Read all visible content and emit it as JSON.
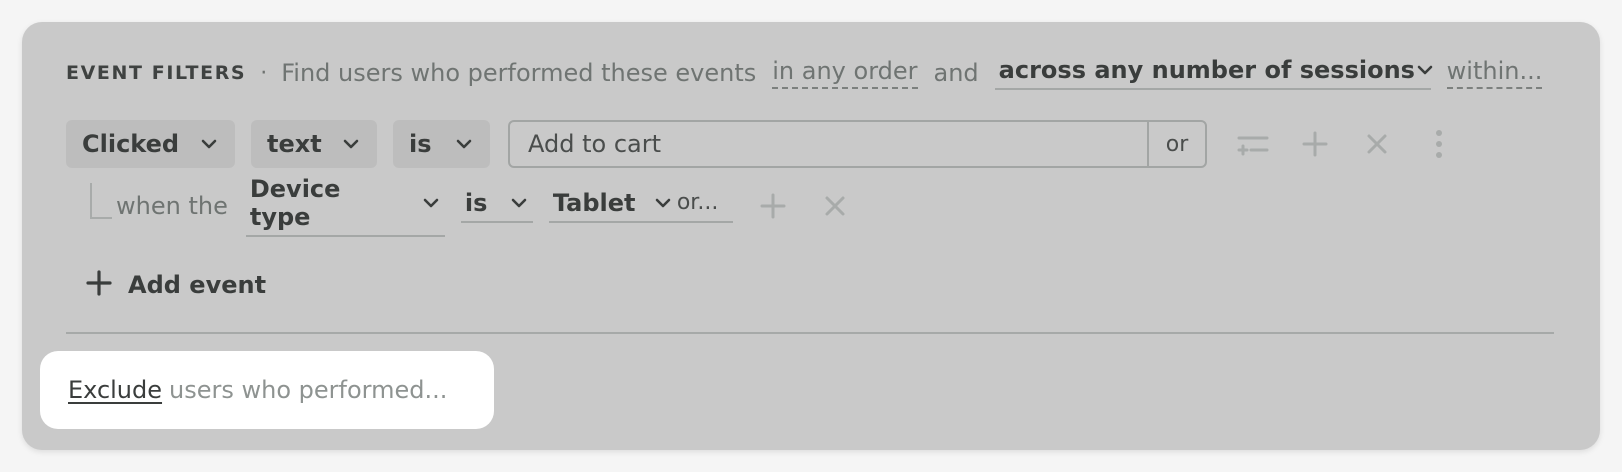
{
  "header": {
    "title": "EVENT FILTERS",
    "separator": "·",
    "description": "Find users who performed these events",
    "order_link": "in any order",
    "conjunction": "and",
    "sessions_select": "across any number of sessions",
    "within_link": "within..."
  },
  "event_row": {
    "action_select": "Clicked",
    "property_select": "text",
    "operator_select": "is",
    "value_input": "Add to cart",
    "or_button": "or",
    "icons": [
      "filter-toggle-icon",
      "add-icon",
      "remove-icon",
      "more-vertical-icon"
    ]
  },
  "condition_row": {
    "prefix": "when the",
    "property_select": "Device type",
    "operator_select": "is",
    "value_select": "Tablet",
    "or_more": "or...",
    "icons": [
      "add-icon",
      "remove-icon"
    ]
  },
  "add_event": {
    "label": "Add event"
  },
  "exclude": {
    "link": "Exclude",
    "text": "users who performed..."
  },
  "colors": {
    "panel_bg": "#c9c9c9",
    "pill_bg": "#bdbdbd",
    "text_dark": "#3a3d3c",
    "text_muted": "#6f7472",
    "icon_muted": "#a8abaa",
    "card_bg": "#ffffff"
  }
}
